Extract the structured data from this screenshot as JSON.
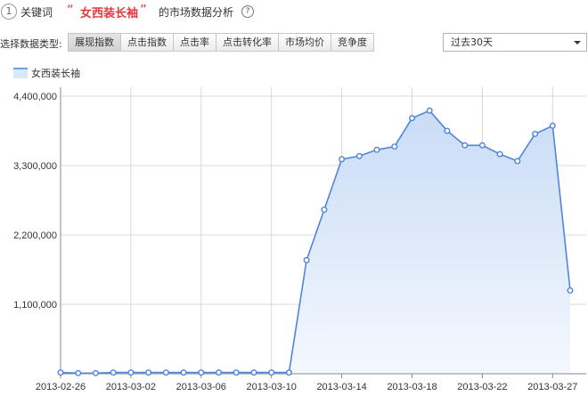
{
  "header": {
    "step": "1",
    "prefix": "关键词",
    "quote_open": "“",
    "keyword": "女西装长袖",
    "quote_close": "”",
    "suffix": "的市场数据分析",
    "help_icon": "question-circle-icon"
  },
  "filter": {
    "label": "选择数据类型:",
    "tabs": [
      {
        "label": "展现指数",
        "active": true
      },
      {
        "label": "点击指数",
        "active": false
      },
      {
        "label": "点击率",
        "active": false
      },
      {
        "label": "点击转化率",
        "active": false
      },
      {
        "label": "市场均价",
        "active": false
      },
      {
        "label": "竞争度",
        "active": false
      }
    ],
    "range_value": "过去30天"
  },
  "colors": {
    "line": "#4f86d8",
    "fill_top": "#c9dcf6",
    "fill_bottom": "#f4f8fe",
    "grid": "#d8d8d8",
    "keyword": "#e4393c"
  },
  "chart_data": {
    "type": "area",
    "legend": [
      "女西装长袖"
    ],
    "ylim": [
      0,
      4400000
    ],
    "yticks": [
      "1,100,000",
      "2,200,000",
      "3,300,000",
      "4,400,000"
    ],
    "ytick_values": [
      1100000,
      2200000,
      3300000,
      4400000
    ],
    "xticks": [
      "2013-02-26",
      "2013-03-02",
      "2013-03-06",
      "2013-03-10",
      "2013-03-14",
      "2013-03-18",
      "2013-03-22",
      "2013-03-27"
    ],
    "xtick_index": [
      0,
      4,
      8,
      12,
      16,
      20,
      24,
      28
    ],
    "grid": true,
    "series": [
      {
        "name": "女西装长袖",
        "values": [
          20000,
          10000,
          10000,
          20000,
          20000,
          20000,
          20000,
          20000,
          20000,
          20000,
          20000,
          20000,
          20000,
          20000,
          1800000,
          2600000,
          3400000,
          3450000,
          3550000,
          3600000,
          4050000,
          4170000,
          3850000,
          3620000,
          3620000,
          3480000,
          3370000,
          3800000,
          3930000,
          1320000
        ]
      }
    ]
  }
}
